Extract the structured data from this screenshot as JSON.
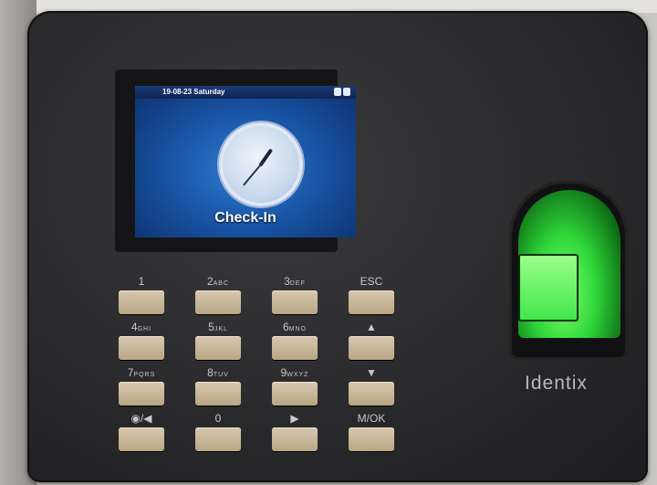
{
  "screen": {
    "status_date": "19-08-23  Saturday",
    "label": "Check-In"
  },
  "keypad": {
    "keys": [
      {
        "main": "1",
        "sub": ""
      },
      {
        "main": "2",
        "sub": "ABC"
      },
      {
        "main": "3",
        "sub": "DEF"
      },
      {
        "main": "ESC",
        "sub": ""
      },
      {
        "main": "4",
        "sub": "GHI"
      },
      {
        "main": "5",
        "sub": "JKL"
      },
      {
        "main": "6",
        "sub": "MNO"
      },
      {
        "main": "▲",
        "sub": ""
      },
      {
        "main": "7",
        "sub": "PQRS"
      },
      {
        "main": "8",
        "sub": "TUV"
      },
      {
        "main": "9",
        "sub": "WXYZ"
      },
      {
        "main": "▼",
        "sub": ""
      },
      {
        "main": "◉/◀",
        "sub": ""
      },
      {
        "main": "0",
        "sub": ""
      },
      {
        "main": "▶",
        "sub": ""
      },
      {
        "main": "M/OK",
        "sub": ""
      }
    ]
  },
  "brand": "Identix",
  "colors": {
    "device_body": "#2a2a2c",
    "screen_blue": "#1a56a8",
    "sensor_green": "#2fd63a",
    "key_beige": "#c9b898"
  },
  "icons": {
    "clock": "analog-clock-icon",
    "battery": "battery-icon",
    "lock": "lock-icon"
  }
}
